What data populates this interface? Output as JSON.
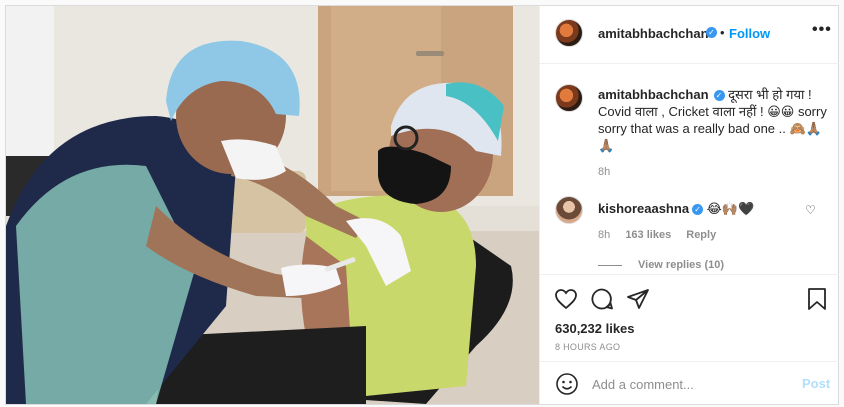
{
  "post": {
    "username": "amitabhbachchan",
    "follow_label": "Follow",
    "dot": "•",
    "more_label": "•••",
    "verified_glyph": "✓"
  },
  "caption": {
    "username": "amitabhbachchan",
    "text": "दूसरा भी हो गया ! Covid वाला , Cricket वाला नहीं ! 😀😀 sorry sorry that was a really bad one .. 🙈🙏🏽🙏🏽",
    "time": "8h"
  },
  "comment": {
    "username": "kishoreaashna",
    "text": "😂🙌🏽🖤",
    "time": "8h",
    "likes": "163 likes",
    "reply_label": "Reply",
    "view_replies": "View replies (10)",
    "heart_glyph": "♡"
  },
  "actions": {
    "likes_count": "630,232 likes",
    "time_ago": "8 HOURS AGO"
  },
  "add_comment": {
    "placeholder": "Add a comment...",
    "post_label": "Post"
  },
  "colors": {
    "accent": "#0095f6",
    "post_disabled": "#b2dffc",
    "muted": "#8e8e8e",
    "text": "#262626"
  },
  "icons": [
    "heart-icon",
    "comment-icon",
    "share-icon",
    "bookmark-icon",
    "emoji-icon",
    "more-icon",
    "verified-icon"
  ]
}
